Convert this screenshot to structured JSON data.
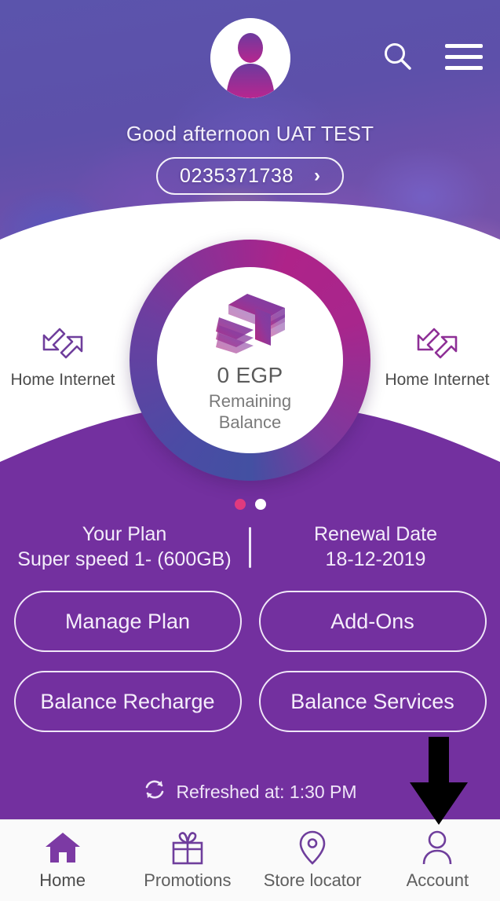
{
  "header": {
    "avatar_name": "user-avatar",
    "search_label": "Search",
    "menu_label": "Menu",
    "greeting": "Good afternoon UAT TEST",
    "phone_number": "0235371738",
    "phone_chevron": "›"
  },
  "balance": {
    "amount": "0 EGP",
    "label_line1": "Remaining",
    "label_line2": "Balance",
    "icon": "money-stack-icon",
    "ring_gradient_start": "#4350a2",
    "ring_gradient_end": "#ae2389"
  },
  "shortcuts": [
    {
      "label": "Home Internet",
      "icon": "data-transfer-arrows-icon"
    },
    {
      "label": "Home Internet",
      "icon": "data-transfer-arrows-icon"
    }
  ],
  "carousel": {
    "dots": [
      {
        "state": "active",
        "color": "#e03a7e"
      },
      {
        "state": "inactive",
        "color": "#ffffff"
      }
    ]
  },
  "plan": {
    "plan_title": "Your Plan",
    "plan_value": "Super speed 1- (600GB)",
    "renewal_title": "Renewal Date",
    "renewal_value": "18-12-2019"
  },
  "actions": [
    {
      "label": "Manage Plan"
    },
    {
      "label": "Add-Ons"
    },
    {
      "label": "Balance Recharge"
    },
    {
      "label": "Balance Services"
    }
  ],
  "refresh": {
    "icon": "refresh-icon",
    "text": "Refreshed at: 1:30 PM"
  },
  "annotation": {
    "type": "down-arrow-icon",
    "color": "#000000",
    "points_to": "Account"
  },
  "bottom_nav": [
    {
      "label": "Home",
      "icon": "home-icon",
      "active": true
    },
    {
      "label": "Promotions",
      "icon": "gift-icon",
      "active": false
    },
    {
      "label": "Store locator",
      "icon": "map-pin-icon",
      "active": false
    },
    {
      "label": "Account",
      "icon": "person-icon",
      "active": false
    }
  ],
  "theme": {
    "purple": "#73309f",
    "magenta": "#ae2389",
    "blue_purple": "#4350a2",
    "nav_bg": "#fafafa"
  }
}
